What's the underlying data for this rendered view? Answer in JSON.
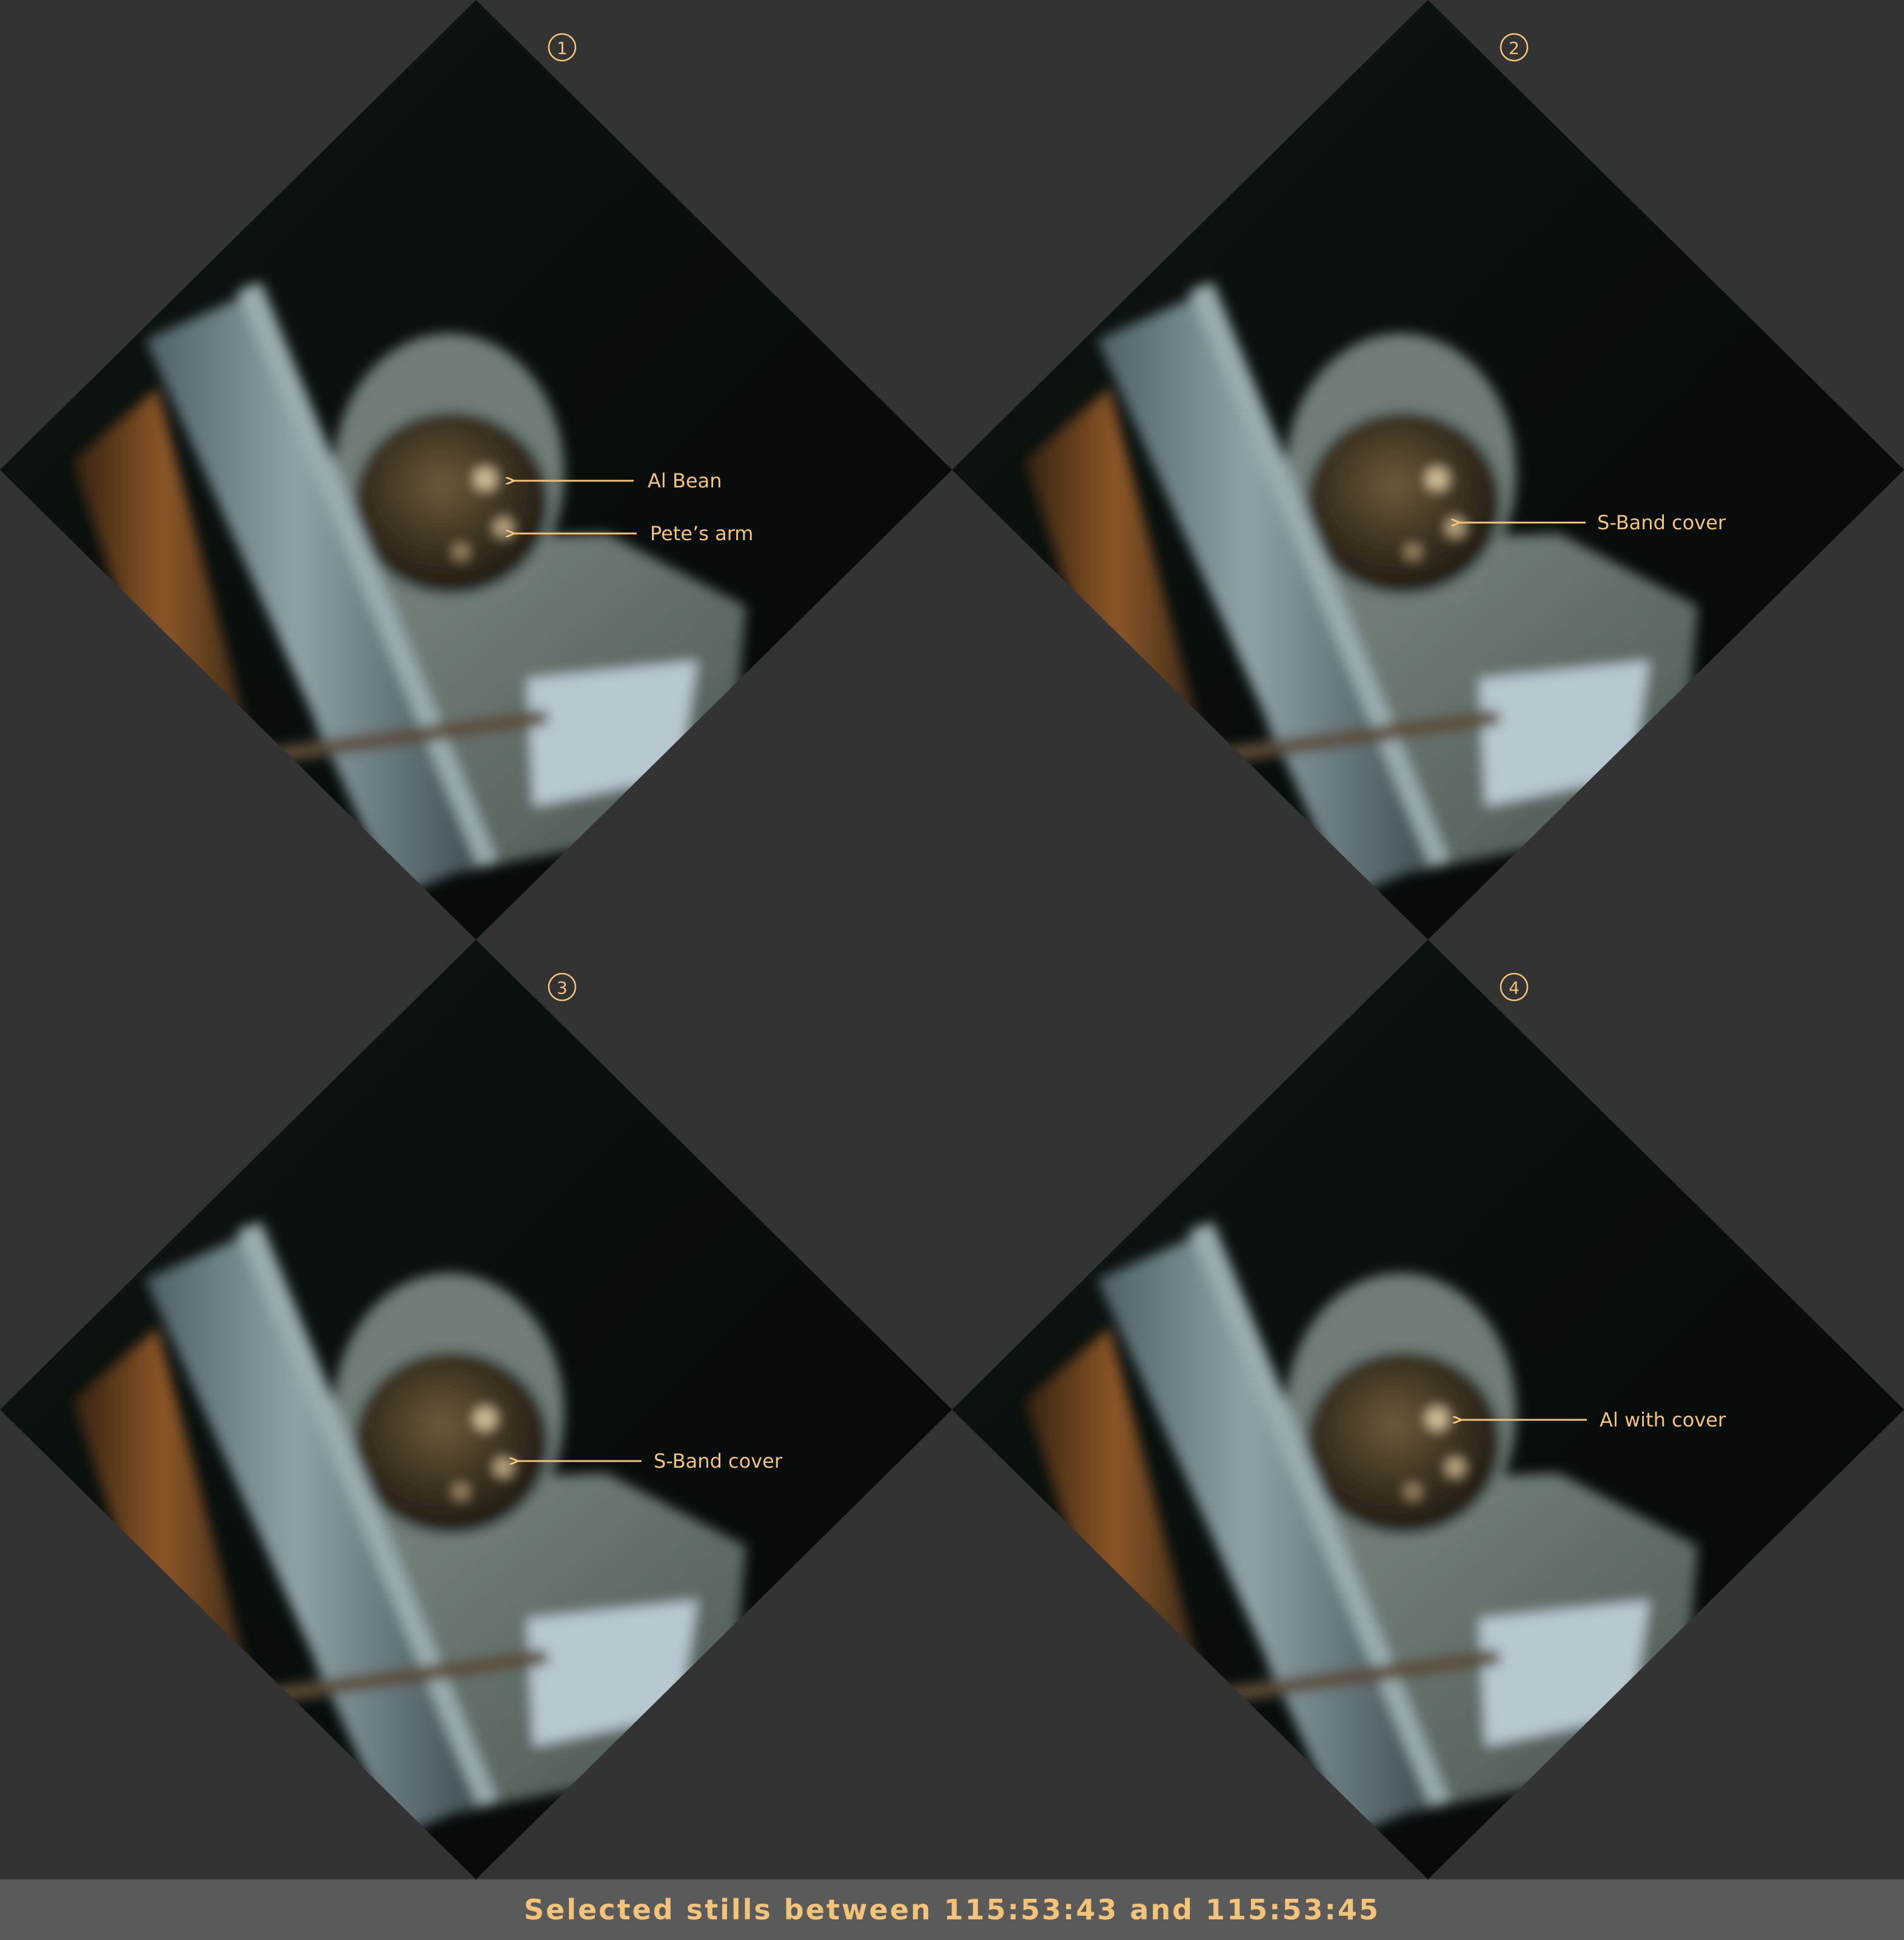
{
  "caption": "Selected stills between 115:53:43 and 115:53:45",
  "colors": {
    "background": "#333333",
    "caption_bar": "#5a5a5a",
    "annotation": "#f4c37a"
  },
  "frames": [
    {
      "number": "1",
      "labels": [
        {
          "text": "Al Bean"
        },
        {
          "text": "Pete’s arm"
        }
      ]
    },
    {
      "number": "2",
      "labels": [
        {
          "text": "S-Band cover"
        }
      ]
    },
    {
      "number": "3",
      "labels": [
        {
          "text": "S-Band cover"
        }
      ]
    },
    {
      "number": "4",
      "labels": [
        {
          "text": "Al with cover"
        }
      ]
    }
  ]
}
